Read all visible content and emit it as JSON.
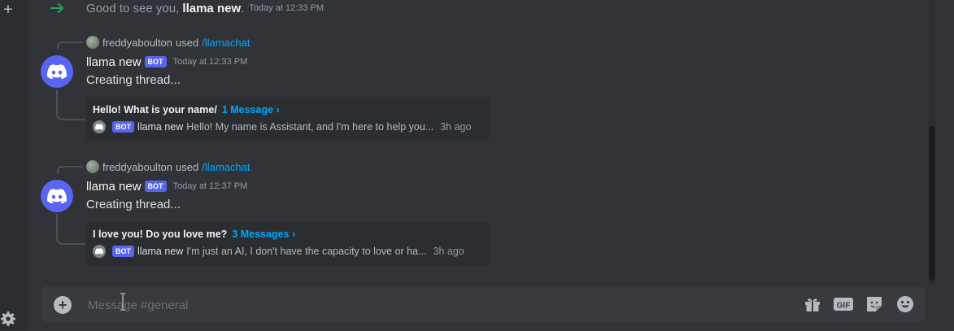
{
  "composer": {
    "placeholder": "Message #general"
  },
  "system_message": {
    "greeting": "Good to see you, ",
    "user": "llama new",
    "period": ".",
    "timestamp": "Today at 12:33 PM"
  },
  "messages": [
    {
      "reply": {
        "user": "freddyaboulton",
        "used": "used",
        "command": "/llamachat"
      },
      "author": "llama new",
      "bot_tag": "BOT",
      "timestamp": "Today at 12:33 PM",
      "content": "Creating thread...",
      "thread": {
        "name": "Hello! What is your name/",
        "count": "1 Message ›",
        "bot_tag": "BOT",
        "last_user": "llama new",
        "last_preview": "Hello! My name is Assistant, and I'm here to help you...",
        "age": "3h ago"
      }
    },
    {
      "reply": {
        "user": "freddyaboulton",
        "used": "used",
        "command": "/llamachat"
      },
      "author": "llama new",
      "bot_tag": "BOT",
      "timestamp": "Today at 12:37 PM",
      "content": "Creating thread...",
      "thread": {
        "name": "I love you! Do you love me?",
        "count": "3 Messages ›",
        "bot_tag": "BOT",
        "last_user": "llama new",
        "last_preview": "I'm just an AI, I don't have the capacity to love or ha...",
        "age": "3h ago"
      }
    }
  ],
  "colors": {
    "background": "#313338",
    "sidebar": "#2b2d31",
    "blurple": "#5865f2",
    "link": "#00a8fc",
    "join_arrow": "#23a55a"
  }
}
